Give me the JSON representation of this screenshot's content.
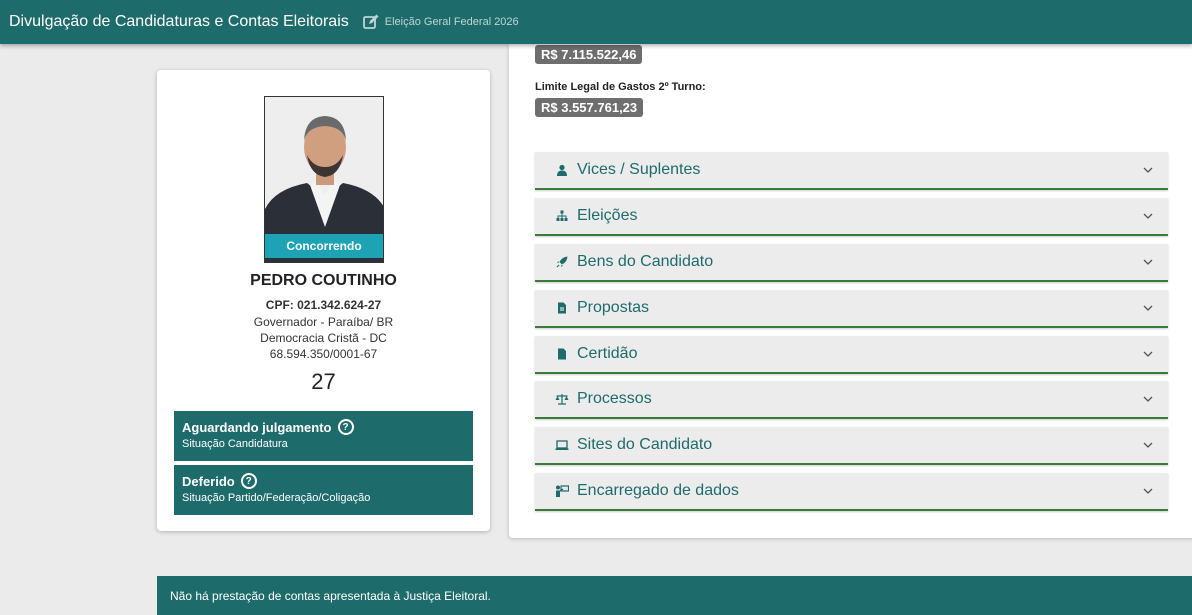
{
  "header": {
    "title": "Divulgação de Candidaturas e Contas Eleitorais",
    "election": "Eleição Geral Federal 2026"
  },
  "candidate": {
    "photo_badge": "Concorrendo",
    "name": "PEDRO COUTINHO",
    "cpf": "CPF: 021.342.624-27",
    "office": "Governador - Paraíba/ BR",
    "party": "Democracia Cristã - DC",
    "cnpj": "68.594.350/0001-67",
    "number": "27",
    "status": [
      {
        "title": "Aguardando julgamento",
        "subtitle": "Situação Candidatura"
      },
      {
        "title": "Deferido",
        "subtitle": "Situação Partido/Federação/Coligação"
      }
    ]
  },
  "finance": {
    "limit_1": "R$ 7.115.522,46",
    "limit_2_label": "Limite Legal de Gastos 2º Turno:",
    "limit_2": "R$ 3.557.761,23"
  },
  "sections": [
    {
      "label": "Vices / Suplentes",
      "icon": "person-icon"
    },
    {
      "label": "Eleições",
      "icon": "sitemap-icon"
    },
    {
      "label": "Bens do Candidato",
      "icon": "rocket-icon"
    },
    {
      "label": "Propostas",
      "icon": "document-icon"
    },
    {
      "label": "Certidão",
      "icon": "file-icon"
    },
    {
      "label": "Processos",
      "icon": "scale-icon"
    },
    {
      "label": "Sites do Candidato",
      "icon": "laptop-icon"
    },
    {
      "label": "Encarregado de dados",
      "icon": "person-board-icon"
    }
  ],
  "footer": {
    "message": "Não há prestação de contas apresentada à Justiça Eleitoral."
  },
  "colors": {
    "primary": "#1e6b6b",
    "badge_cyan": "#1ea3b5",
    "money_badge": "#6e6e6e",
    "accordion_border": "#3a7a3a"
  }
}
